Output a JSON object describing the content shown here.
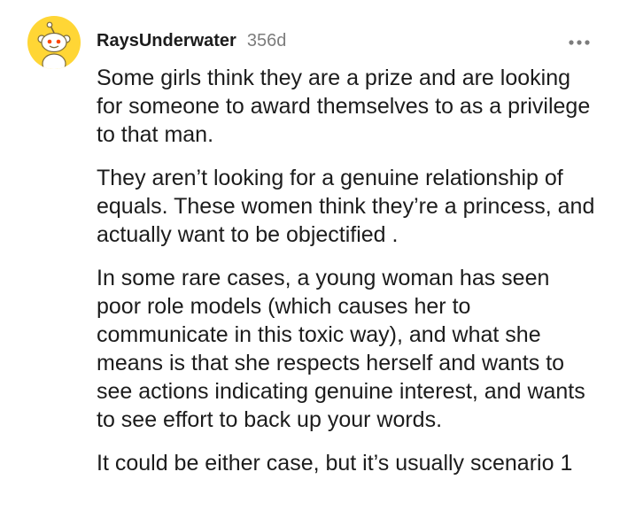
{
  "comment": {
    "author": "RaysUnderwater",
    "age": "356d",
    "paragraphs": [
      "Some girls think they are a prize and are looking for someone to award themselves to as a privilege to that man.",
      "They aren’t looking for a genuine relationship of equals. These women think they’re a princess, and actually want to be objectified .",
      "In some rare cases, a young woman has seen poor role models (which causes her to communicate in this toxic way), and what she means is that she respects herself and wants to see actions indicating genuine interest, and wants to see effort to back up your words.",
      "It could be either case, but it’s usually scenario 1"
    ]
  },
  "icons": {
    "avatar": "snoo-avatar-icon",
    "more": "more-options-icon"
  },
  "colors": {
    "avatar_bg": "#ffd635",
    "text": "#1c1c1c",
    "meta": "#7c7c7c"
  }
}
